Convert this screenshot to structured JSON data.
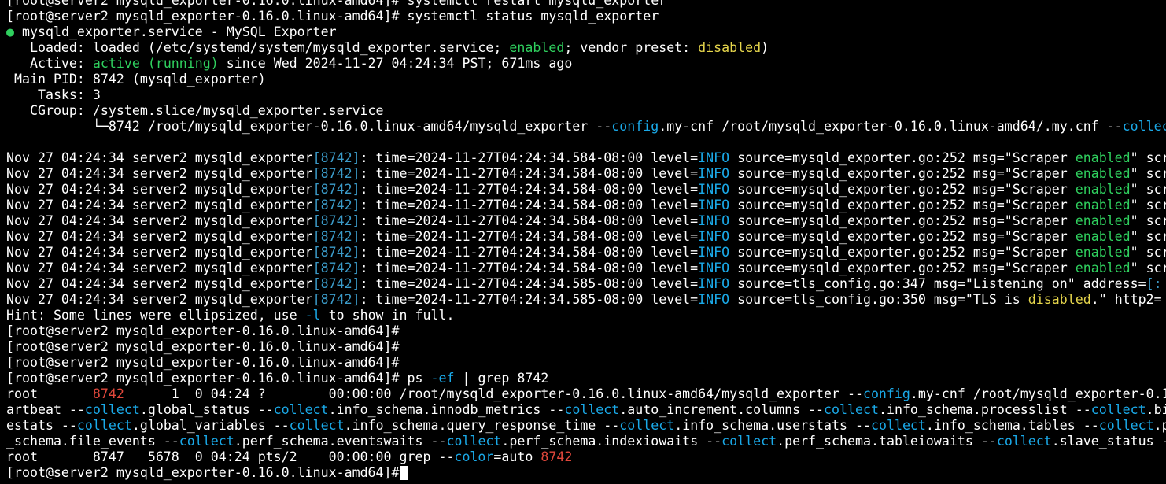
{
  "colors": {
    "background": "#000000",
    "text": "#ffffff",
    "green": "#2fd05e",
    "yellow": "#e6d64c",
    "cyan": "#3b9bc9",
    "blue": "#1aa9e8",
    "red": "#e0473b"
  },
  "prompt": "[root@server2 mysqld_exporter-0.16.0.linux-amd64]#",
  "cmd_restart": " systemctl restart mysqld_exporter",
  "cmd_status": " systemctl status mysqld_exporter",
  "status": {
    "dot": "●",
    "unit_line": " mysqld_exporter.service - MySQL Exporter",
    "loaded_prefix": "   Loaded: loaded (/etc/systemd/system/mysqld_exporter.service; ",
    "loaded_enabled": "enabled",
    "loaded_mid": "; vendor preset: ",
    "loaded_preset": "disabled",
    "loaded_suffix": ")",
    "active_prefix": "   Active: ",
    "active_state": "active (running)",
    "active_suffix": " since Wed 2024-11-27 04:24:34 PST; 671ms ago",
    "mainpid": " Main PID: 8742 (mysqld_exporter)",
    "tasks": "    Tasks: 3",
    "cgroup": "   CGroup: /system.slice/mysqld_exporter.service",
    "tree_prefix": "           └─8742 /root/mysqld_exporter-0.16.0.linux-amd64/mysqld_exporter --",
    "tree_config": "config",
    "tree_mid": ".my-cnf /root/mysqld_exporter-0.16.0.linux-amd64/.my.cnf --",
    "tree_collect": "collect"
  },
  "logs": {
    "prefix": "Nov 27 04:24:34 server2 mysqld_exporter",
    "pid": "[8742]",
    "time_a": ": time=2024-11-27T04:24:34.584-08:00 level=",
    "time_b": ": time=2024-11-27T04:24:34.585-08:00 level=",
    "level": "INFO",
    "scraper_mid": " source=mysqld_exporter.go:252 msg=\"Scraper ",
    "scraper_enabled": "enabled",
    "scraper_tail": "\" scr",
    "listen_mid": " source=tls_config.go:347 msg=\"Listening on\" address=",
    "listen_addr": "[:",
    "tls_mid": " source=tls_config.go:350 msg=\"TLS is ",
    "tls_disabled": "disabled",
    "tls_tail": ".\" http2="
  },
  "hint": {
    "prefix": "Hint: Some lines were ellipsized, use ",
    "flag": "-l",
    "suffix": " to show in full."
  },
  "ps": {
    "cmd_ps": " ps ",
    "cmd_ef": "-ef",
    "cmd_grep": " | grep 8742",
    "row1_user": "root      ",
    "row1_pid": " 8742",
    "row1_rest": "      1  0 04:24 ?        00:00:00 /root/mysqld_exporter-0.16.0.linux-amd64/mysqld_exporter --",
    "row1_config": "config",
    "row1_tail": ".my-cnf /root/mysqld_exporter-0.1",
    "wrap1": [
      {
        "c": "",
        "t": "artbeat --"
      },
      {
        "c": "blue",
        "t": "collect"
      },
      {
        "c": "",
        "t": ".global_status --"
      },
      {
        "c": "blue",
        "t": "collect"
      },
      {
        "c": "",
        "t": ".info_schema.innodb_metrics --"
      },
      {
        "c": "blue",
        "t": "collect"
      },
      {
        "c": "",
        "t": ".auto_increment.columns --"
      },
      {
        "c": "blue",
        "t": "collect"
      },
      {
        "c": "",
        "t": ".info_schema.processlist --"
      },
      {
        "c": "blue",
        "t": "collect"
      },
      {
        "c": "",
        "t": ".bi"
      }
    ],
    "wrap2": [
      {
        "c": "",
        "t": "estats --"
      },
      {
        "c": "blue",
        "t": "collect"
      },
      {
        "c": "",
        "t": ".global_variables --"
      },
      {
        "c": "blue",
        "t": "collect"
      },
      {
        "c": "",
        "t": ".info_schema.query_response_time --"
      },
      {
        "c": "blue",
        "t": "collect"
      },
      {
        "c": "",
        "t": ".info_schema.userstats --"
      },
      {
        "c": "blue",
        "t": "collect"
      },
      {
        "c": "",
        "t": ".info_schema.tables --"
      },
      {
        "c": "blue",
        "t": "collect"
      },
      {
        "c": "",
        "t": ".p"
      }
    ],
    "wrap3": [
      {
        "c": "",
        "t": "_schema.file_events --"
      },
      {
        "c": "blue",
        "t": "collect"
      },
      {
        "c": "",
        "t": ".perf_schema.eventswaits --"
      },
      {
        "c": "blue",
        "t": "collect"
      },
      {
        "c": "",
        "t": ".perf_schema.indexiowaits --"
      },
      {
        "c": "blue",
        "t": "collect"
      },
      {
        "c": "",
        "t": ".perf_schema.tableiowaits --"
      },
      {
        "c": "blue",
        "t": "collect"
      },
      {
        "c": "",
        "t": ".slave_status -"
      }
    ],
    "row2_prefix": "root       8747   5678  0 04:24 pts/2    00:00:00 grep --",
    "row2_color_flag": "color",
    "row2_mid": "=auto ",
    "row2_pid": "8742"
  }
}
